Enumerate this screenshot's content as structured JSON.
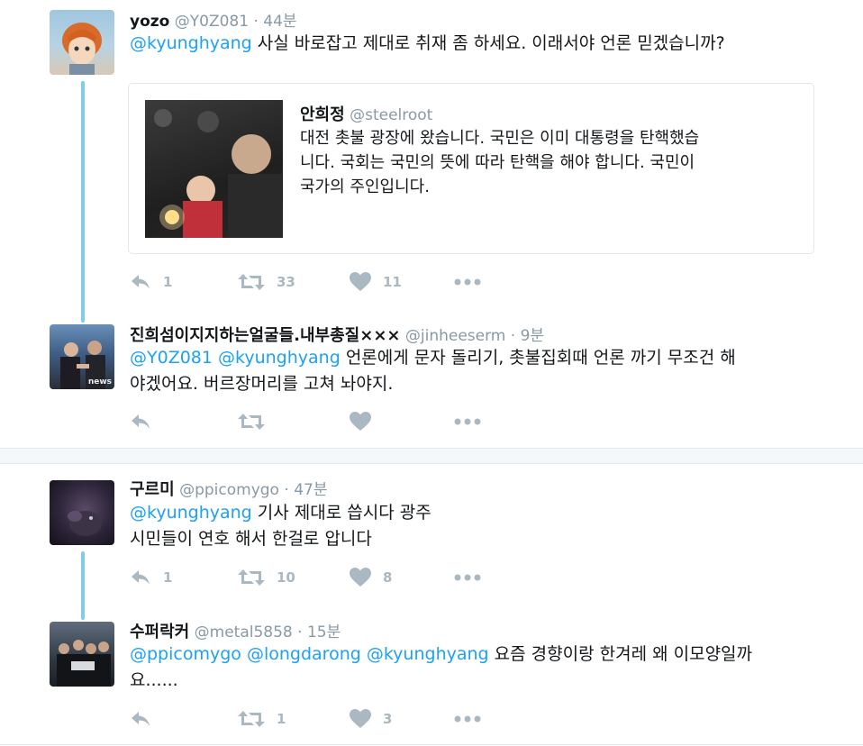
{
  "tweets": [
    {
      "name": "yozo",
      "handle": "@Y0Z081",
      "time": "44분",
      "mention": "@kyunghyang",
      "text": " 사실 바로잡고 제대로 취재 좀 하세요. 이래서야 언론 믿겠습니까?",
      "quote": {
        "name": "안희정",
        "handle": "@steelroot",
        "text_line1": "대전 촛불 광장에 왔습니다. 국민은 이미 대통령을 탄핵했습",
        "text_line2": "니다. 국회는 국민의 뜻에 따라 탄핵을 해야 합니다. 국민이",
        "text_line3": "국가의 주인입니다."
      },
      "replies": "1",
      "retweets": "33",
      "likes": "11"
    },
    {
      "name": "진희섬이지지하는얼굴들.내부총질×××",
      "handle": "@jinheeserm",
      "time": "9분",
      "mention1": "@Y0Z081",
      "mention2": "@kyunghyang",
      "text_line1": " 언론에게 문자 돌리기, 촛불집회때 언론 까기 무조건 해",
      "text_line2": "야겠어요. 버르장머리를 고쳐 놔야지.",
      "avatar_label": "news"
    },
    {
      "name": "구르미",
      "handle": "@ppicomygo",
      "time": "47분",
      "mention": "@kyunghyang",
      "text_line1": " 기사 제대로 씁시다  광주",
      "text_line2": "시민들이 연호 해서 한걸로 압니다",
      "replies": "1",
      "retweets": "10",
      "likes": "8"
    },
    {
      "name": "수퍼락커",
      "handle": "@metal5858",
      "time": "15분",
      "mention1": "@ppicomygo",
      "mention2": "@longdarong",
      "mention3": "@kyunghyang",
      "text_line1": " 요즘 경향이랑 한겨레 왜 이모양일까",
      "text_line2": "요......",
      "retweets": "1",
      "likes": "3"
    }
  ],
  "separator": " · ",
  "colors": {
    "accent": "#1da1f2",
    "thread": "#7fcde8",
    "muted": "#aab8c2",
    "handle": "#8899a6"
  },
  "icons": [
    "reply-icon",
    "retweet-icon",
    "like-icon",
    "more-icon"
  ]
}
